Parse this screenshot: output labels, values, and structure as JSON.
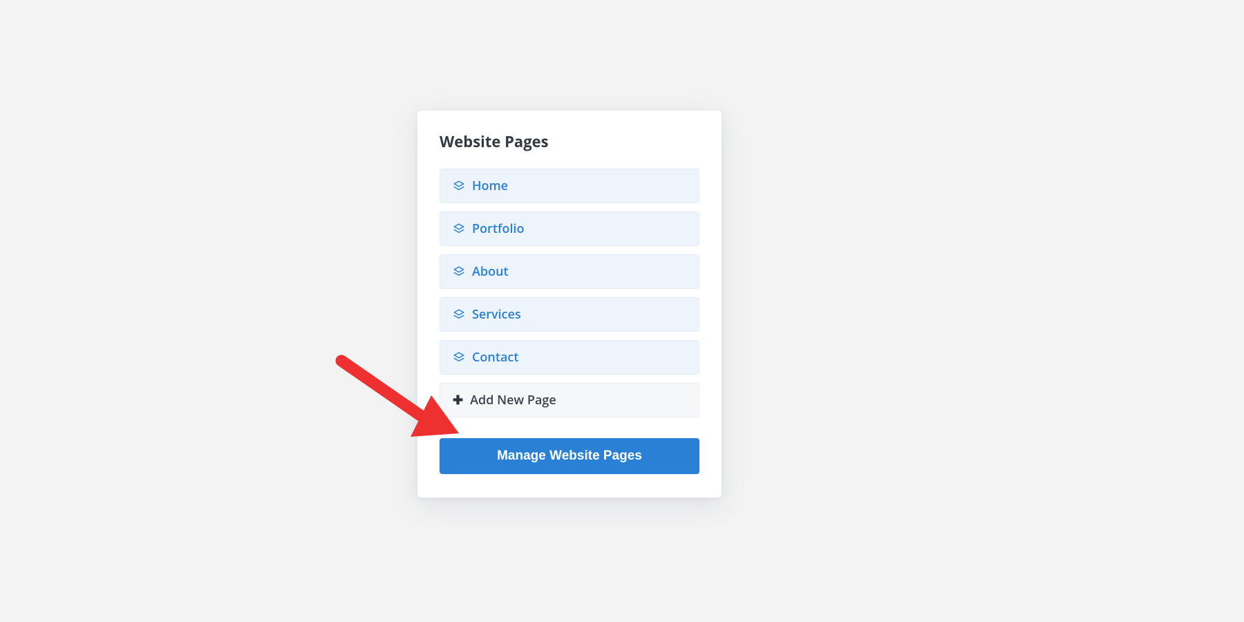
{
  "panel": {
    "title": "Website Pages",
    "pages": [
      {
        "label": "Home"
      },
      {
        "label": "Portfolio"
      },
      {
        "label": "About"
      },
      {
        "label": "Services"
      },
      {
        "label": "Contact"
      }
    ],
    "add_label": "Add New Page",
    "manage_label": "Manage Website Pages"
  },
  "annotation": {
    "arrow_color": "#ef3030"
  }
}
